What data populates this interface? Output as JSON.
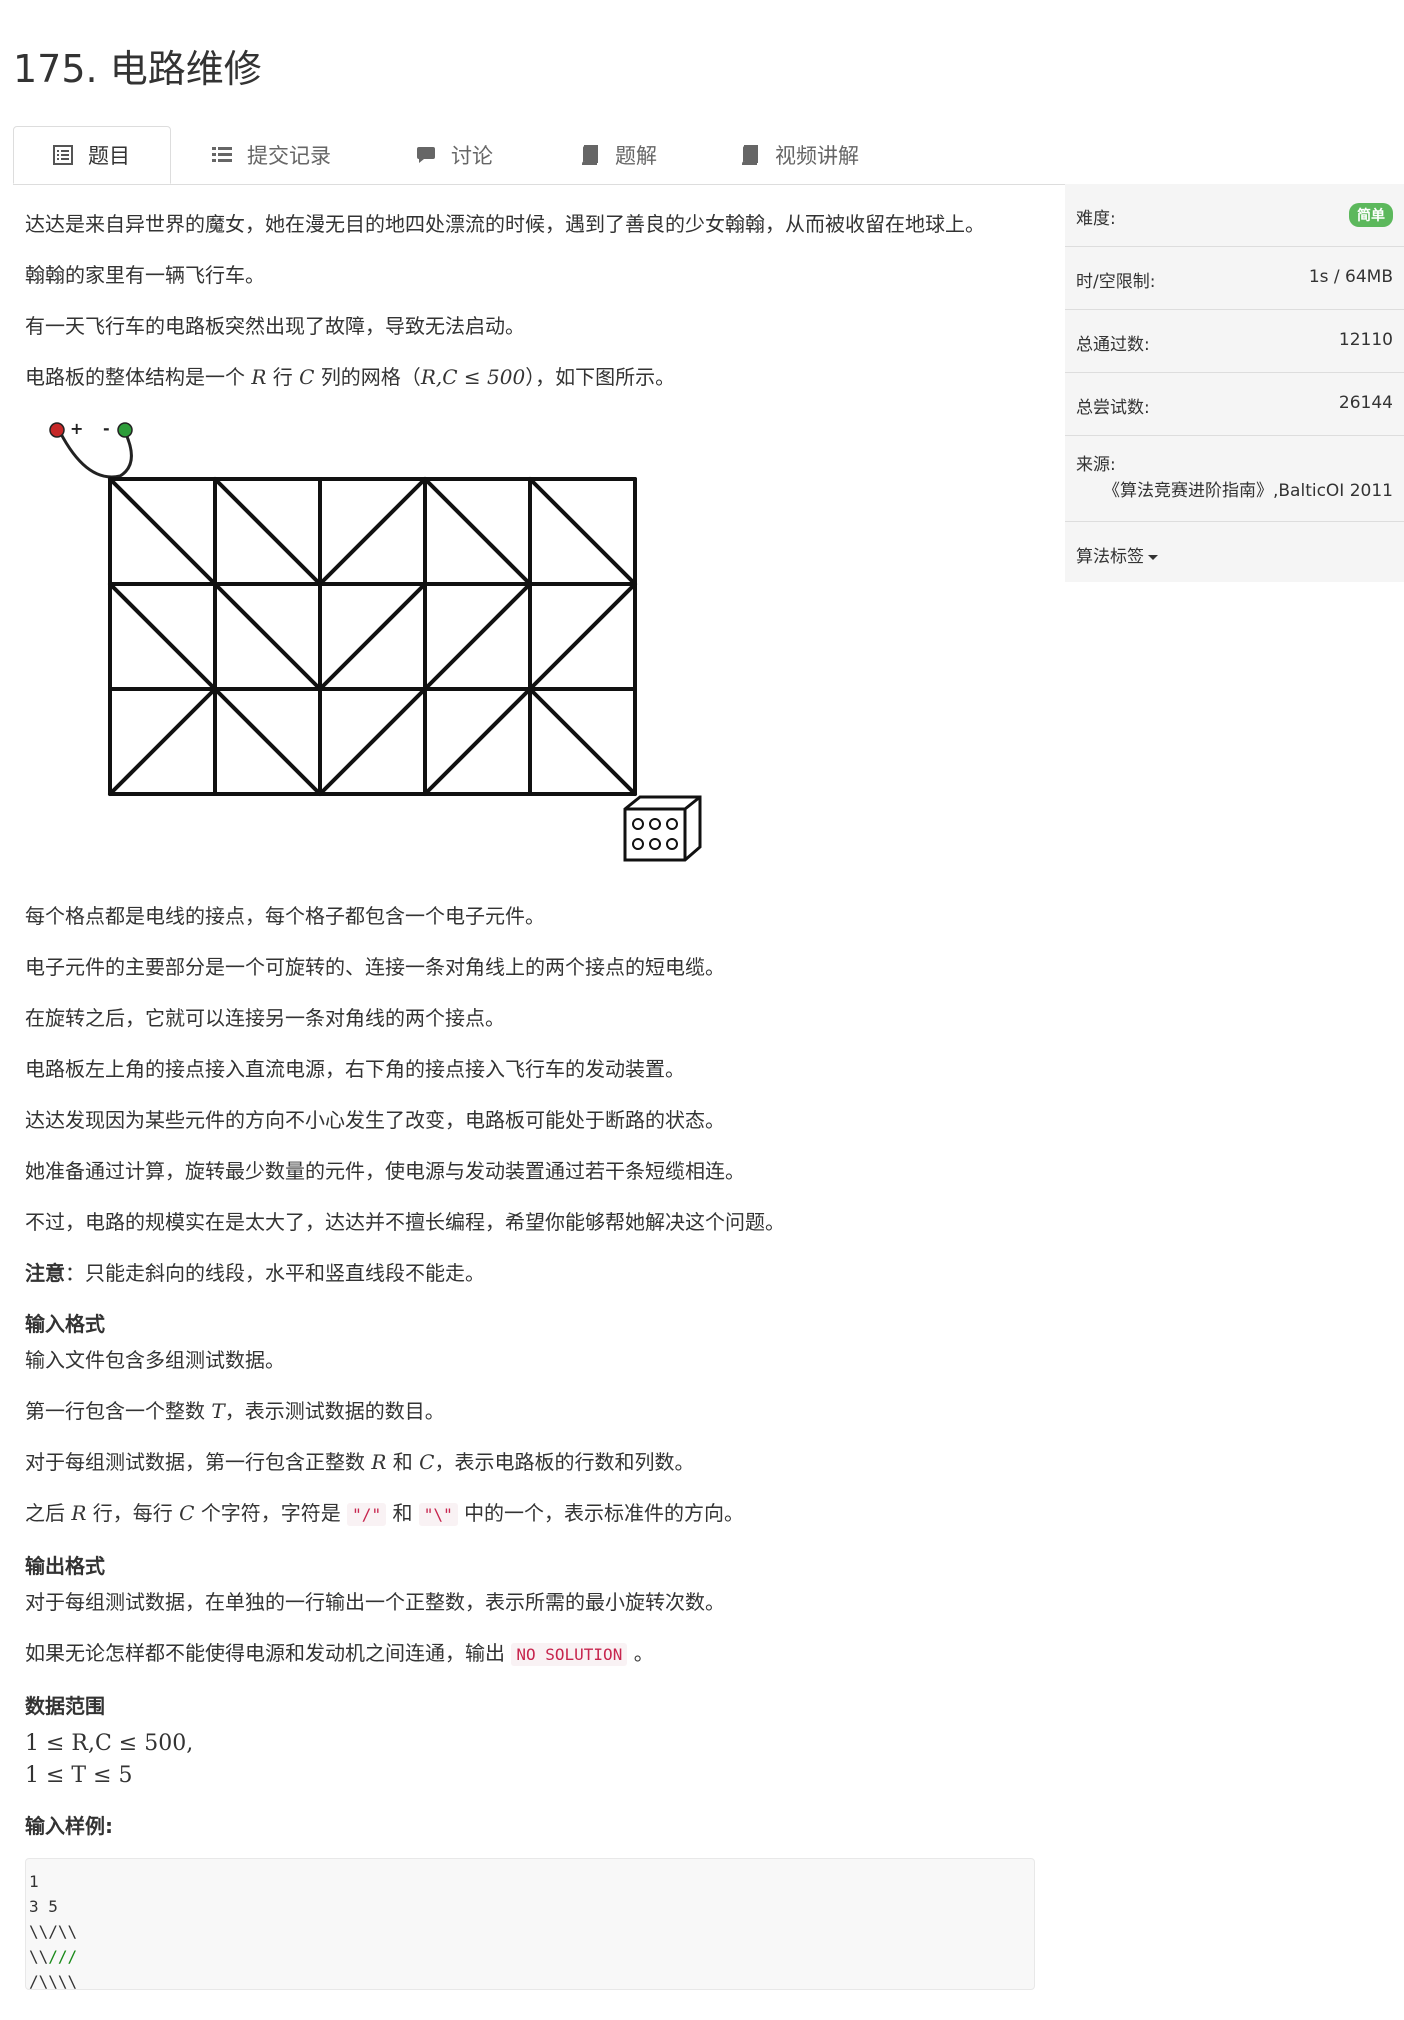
{
  "title": "175. 电路维修",
  "tabs": [
    {
      "label": "题目",
      "icon": "list-alt-icon"
    },
    {
      "label": "提交记录",
      "icon": "list-icon"
    },
    {
      "label": "讨论",
      "icon": "comment-icon"
    },
    {
      "label": "题解",
      "icon": "book-icon"
    },
    {
      "label": "视频讲解",
      "icon": "book-icon"
    }
  ],
  "problem": {
    "p1": "达达是来自异世界的魔女，她在漫无目的地四处漂流的时候，遇到了善良的少女翰翰，从而被收留在地球上。",
    "p2": "翰翰的家里有一辆飞行车。",
    "p3": "有一天飞行车的电路板突然出现了故障，导致无法启动。",
    "p4a": "电路板的整体结构是一个",
    "p4_R": "R",
    "p4b": "行",
    "p4_C": "C",
    "p4c": "列的网格（",
    "p4_math": "R,C ≤ 500",
    "p4d": "），如下图所示。",
    "p5": "每个格点都是电线的接点，每个格子都包含一个电子元件。",
    "p6": "电子元件的主要部分是一个可旋转的、连接一条对角线上的两个接点的短电缆。",
    "p7": "在旋转之后，它就可以连接另一条对角线的两个接点。",
    "p8": "电路板左上角的接点接入直流电源，右下角的接点接入飞行车的发动装置。",
    "p9": "达达发现因为某些元件的方向不小心发生了改变，电路板可能处于断路的状态。",
    "p10": "她准备通过计算，旋转最少数量的元件，使电源与发动装置通过若干条短缆相连。",
    "p11": "不过，电路的规模实在是太大了，达达并不擅长编程，希望你能够帮她解决这个问题。",
    "note_label": "注意",
    "note_text": "：只能走斜向的线段，水平和竖直线段不能走。",
    "input_h": "输入格式",
    "in1": "输入文件包含多组测试数据。",
    "in2a": "第一行包含一个整数",
    "in2_T": "T",
    "in2b": "，表示测试数据的数目。",
    "in3a": "对于每组测试数据，第一行包含正整数",
    "in3_R": "R",
    "in3b": "和",
    "in3_C": "C",
    "in3c": "，表示电路板的行数和列数。",
    "in4a": "之后",
    "in4_R": "R",
    "in4b": "行，每行",
    "in4_C": "C",
    "in4c": "个字符，字符是",
    "in4_code1": "\"/\"",
    "in4d": "和",
    "in4_code2": "\"\\\"",
    "in4e": "中的一个，表示标准件的方向。",
    "output_h": "输出格式",
    "out1": "对于每组测试数据，在单独的一行输出一个正整数，表示所需的最小旋转次数。",
    "out2a": "如果无论怎样都不能使得电源和发动机之间连通，输出",
    "out2_code": "NO SOLUTION",
    "out2b": "。",
    "range_h": "数据范围",
    "range1": "1 ≤ R,C ≤ 500,",
    "range2": "1 ≤ T ≤ 5",
    "sample_h": "输入样例:",
    "sample_l1": "1",
    "sample_l2": "3 5",
    "sample_l3": "\\\\/\\\\",
    "sample_l4a": "\\\\",
    "sample_l4b": "///",
    "sample_l5": "/\\\\\\\\"
  },
  "side": {
    "difficulty_label": "难度:",
    "difficulty_value": "简单",
    "limit_label": "时/空限制:",
    "limit_value": "1s / 64MB",
    "passed_label": "总通过数:",
    "passed_value": "12110",
    "tried_label": "总尝试数:",
    "tried_value": "26144",
    "source_label": "来源:",
    "source_value": "《算法竞赛进阶指南》,BalticOI 2011",
    "tags_label": "算法标签"
  },
  "figure": {
    "plus": "+",
    "minus": "-"
  },
  "colors": {
    "badge": "#5cb85c",
    "code_text": "#c7254e"
  }
}
